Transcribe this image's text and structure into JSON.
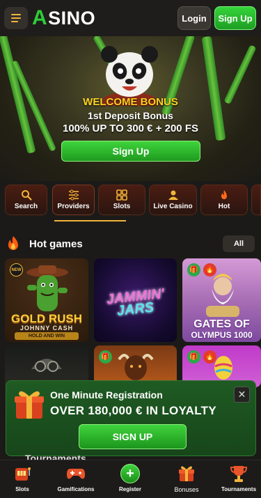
{
  "header": {
    "logo_mark": "A",
    "logo_text": "SINO",
    "login_label": "Login",
    "signup_label": "Sign Up"
  },
  "hero": {
    "welcome": "WELCOME BONUS",
    "deposit": "1st Deposit Bonus",
    "offer": "100% UP TO 300 € + 200 FS",
    "cta": "Sign Up"
  },
  "categories": [
    {
      "label": "Search",
      "icon": "search-icon"
    },
    {
      "label": "Providers",
      "icon": "sliders-icon"
    },
    {
      "label": "Slots",
      "icon": "grid-icon"
    },
    {
      "label": "Live Casino",
      "icon": "dealer-icon"
    },
    {
      "label": "Hot",
      "icon": "fire-icon"
    }
  ],
  "active_category": "Providers",
  "hot_games": {
    "title": "Hot games",
    "all_label": "All",
    "tiles": [
      {
        "line1": "GOLD RUSH",
        "line2": "JOHNNY CASH",
        "line3": "HOLD AND WIN",
        "badge": "NEW"
      },
      {
        "line1": "JAMMIN'",
        "line2": "JARS",
        "line3": ""
      },
      {
        "line1": "GATES OF",
        "line2": "OLYMPUS 1000",
        "line3": ""
      }
    ]
  },
  "popup": {
    "title": "One Minute Registration",
    "subtitle": "OVER 180,000 € IN LOYALTY",
    "cta": "SIGN UP",
    "close_glyph": "✕"
  },
  "peek_title": "Tournaments",
  "bottom_nav": [
    {
      "label": "Slots",
      "icon": "slot-machine-icon"
    },
    {
      "label": "Gamifications",
      "icon": "gamepad-icon"
    },
    {
      "label": "Register",
      "icon": "plus-icon"
    },
    {
      "label": "Bonuses",
      "icon": "gift-icon"
    },
    {
      "label": "Tournaments",
      "icon": "trophy-icon"
    }
  ],
  "colors": {
    "accent_green": "#2ecb38",
    "accent_gold": "#f2b53a",
    "background": "#1c1a18"
  }
}
